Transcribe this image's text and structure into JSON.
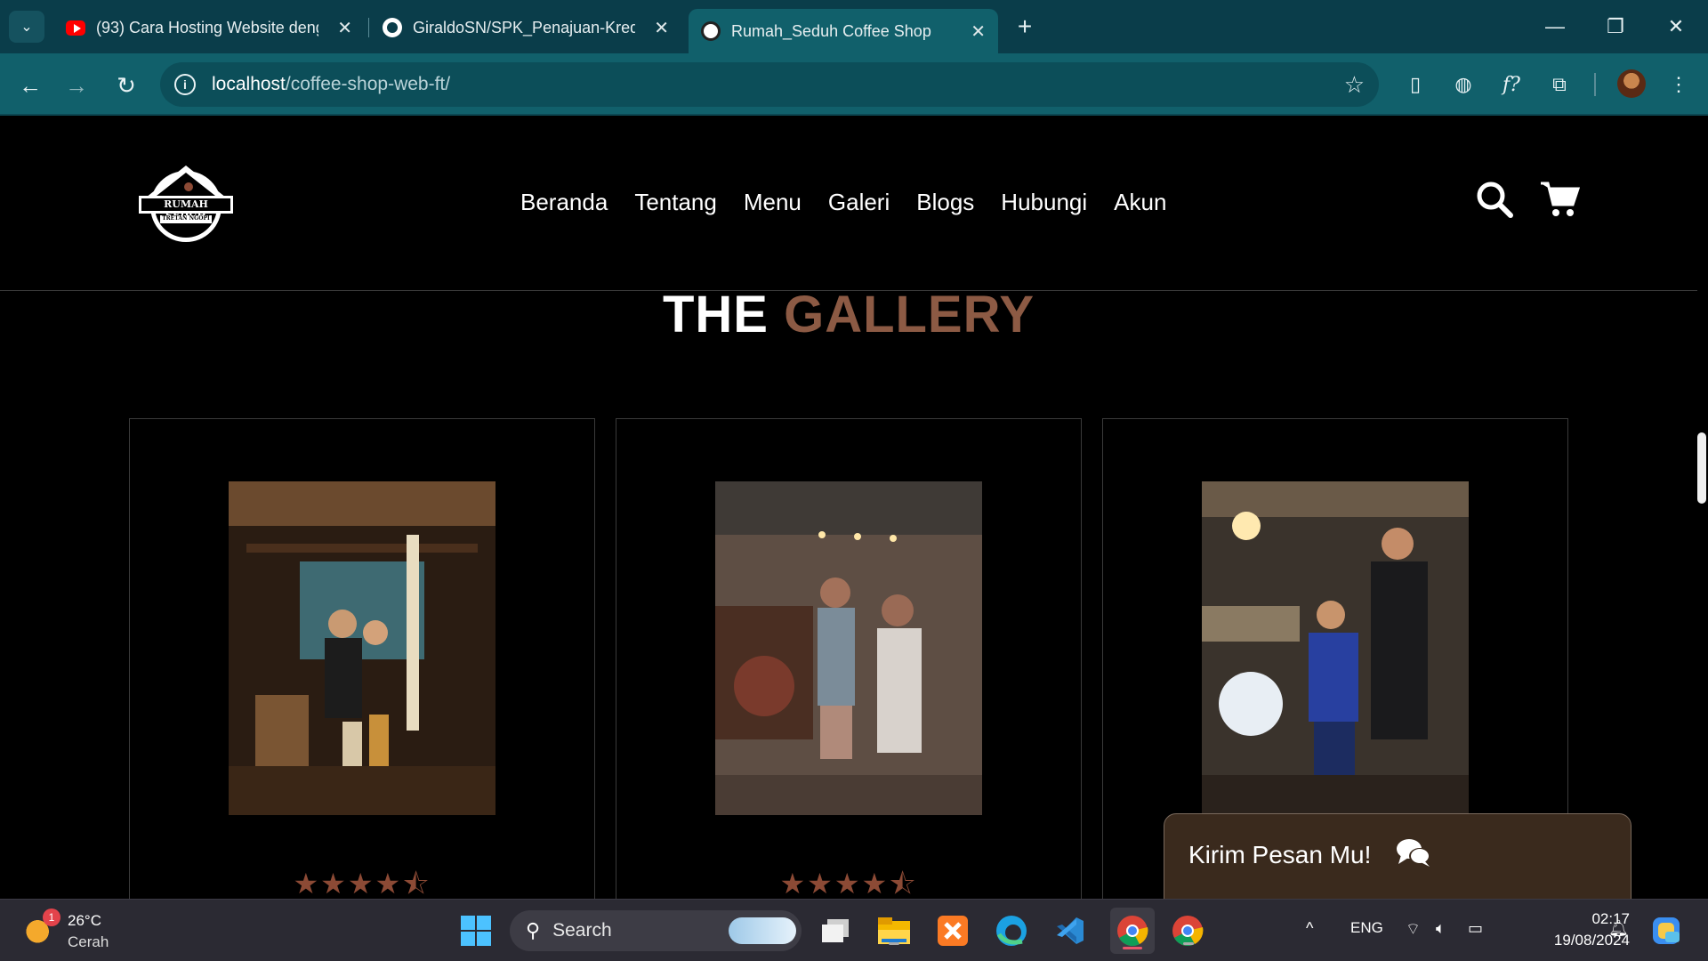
{
  "browser": {
    "tabs": [
      {
        "title": "(93) Cara Hosting Website deng",
        "icon": "youtube-icon"
      },
      {
        "title": "GiraldoSN/SPK_Penajuan-Kredit",
        "icon": "github-icon"
      },
      {
        "title": "Rumah_Seduh Coffee Shop",
        "icon": "rumah-seduh-icon",
        "active": true
      }
    ],
    "url_host": "localhost",
    "url_path": "/coffee-shop-web-ft/"
  },
  "site": {
    "logo": {
      "main": "RUMAH SEDUH",
      "sub": "TRETAN NGOPI"
    },
    "nav": [
      "Beranda",
      "Tentang",
      "Menu",
      "Galeri",
      "Blogs",
      "Hubungi",
      "Akun"
    ],
    "section_title_1": "THE",
    "section_title_2": "GALLERY",
    "accent_color": "#8c5a44",
    "gallery": [
      {
        "photo": "coffee-bar-person-with-baby",
        "rating": 4.5
      },
      {
        "photo": "couple-at-coffee-stall",
        "rating": 4.5
      },
      {
        "photo": "man-and-boy-at-coffee-stall",
        "rating": 4.5
      }
    ],
    "chat_label": "Kirim Pesan Mu!"
  },
  "taskbar": {
    "weather_temp": "26°C",
    "weather_desc": "Cerah",
    "weather_badge": "1",
    "search_label": "Search",
    "lang": "ENG",
    "time": "02:17",
    "date": "19/08/2024"
  }
}
